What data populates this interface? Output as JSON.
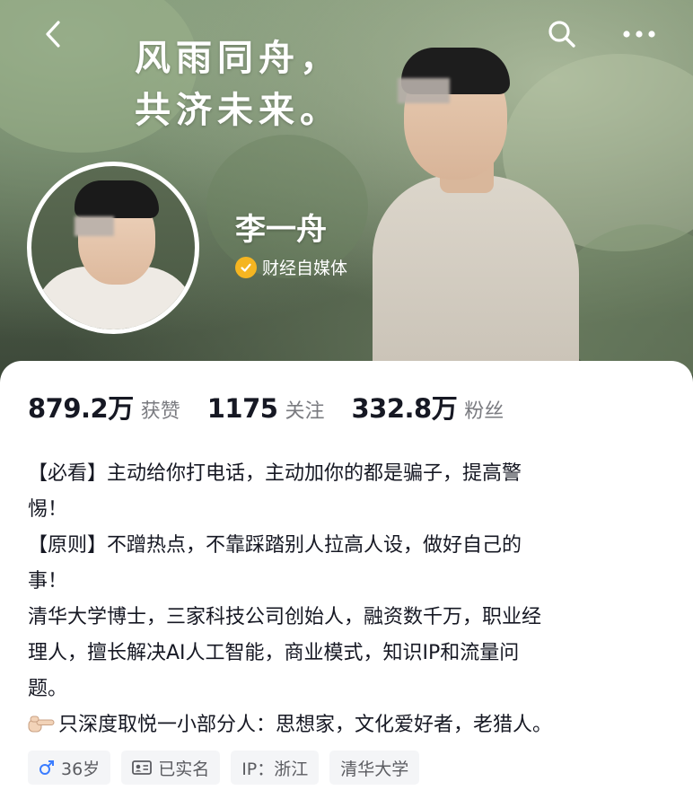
{
  "cover": {
    "slogan_line1": "风雨同舟，",
    "slogan_line2": "共济未来。"
  },
  "nav": {
    "back_icon": "chevron-left-icon",
    "search_icon": "search-icon",
    "more_icon": "more-icon"
  },
  "profile": {
    "name": "李一舟",
    "verification_label": "财经自媒体",
    "verification_color": "#f5b521"
  },
  "stats": [
    {
      "value": "879.2万",
      "label": "获赞"
    },
    {
      "value": "1175",
      "label": "关注"
    },
    {
      "value": "332.8万",
      "label": "粉丝"
    }
  ],
  "bio": {
    "lines": [
      "【必看】主动给你打电话，主动加你的都是骗子，提高警",
      "惕！",
      "【原则】不蹭热点，不靠踩踏别人拉高人设，做好自己的",
      "事！",
      "清华大学博士，三家科技公司创始人，融资数千万，职业经",
      "理人，擅长解决AI人工智能，商业模式，知识IP和流量问",
      "题。",
      "只深度取悦一小部分人：思想家，文化爱好者，老猎人。"
    ],
    "last_line_icon": "pointing-hand-icon"
  },
  "tags": [
    {
      "label": "36岁",
      "icon": "male-icon",
      "icon_color": "#3a7cff"
    },
    {
      "label": "已实名",
      "icon": "id-card-icon"
    },
    {
      "label": "IP：浙江"
    },
    {
      "label": "清华大学"
    }
  ]
}
